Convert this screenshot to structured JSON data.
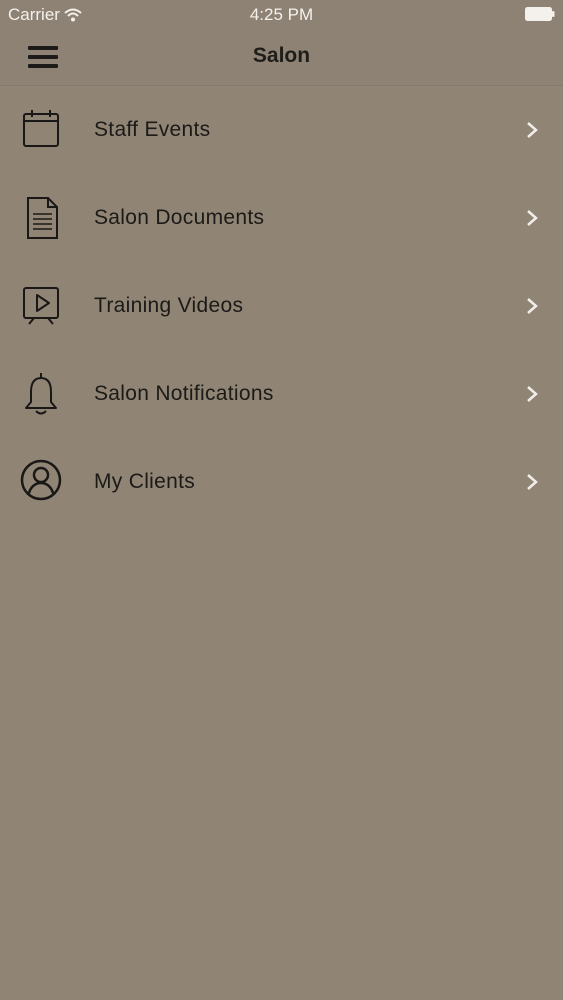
{
  "status_bar": {
    "carrier": "Carrier",
    "time": "4:25 PM",
    "icons": [
      "wifi-icon",
      "battery-icon"
    ]
  },
  "nav": {
    "title": "Salon",
    "menu_icon": "hamburger-menu-icon"
  },
  "menu": {
    "items": [
      {
        "label": "Staff Events",
        "icon": "calendar-icon"
      },
      {
        "label": "Salon Documents",
        "icon": "document-icon"
      },
      {
        "label": "Training Videos",
        "icon": "video-presentation-icon"
      },
      {
        "label": "Salon Notifications",
        "icon": "bell-icon"
      },
      {
        "label": "My Clients",
        "icon": "user-circle-icon"
      }
    ]
  },
  "colors": {
    "background": "#908475",
    "bar": "#8e8274",
    "text": "#1c1a17",
    "chevron": "#f2efea"
  }
}
